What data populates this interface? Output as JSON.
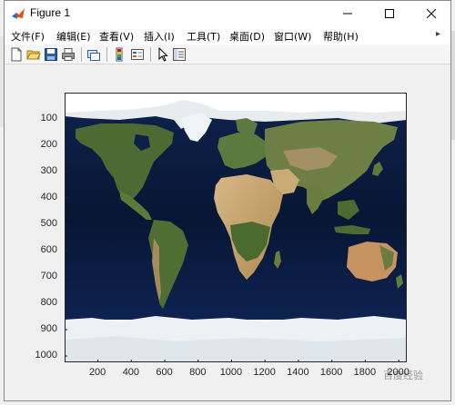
{
  "window": {
    "title": "Figure 1"
  },
  "menubar": {
    "items": [
      {
        "label": "文件(F)"
      },
      {
        "label": "编辑(E)"
      },
      {
        "label": "查看(V)"
      },
      {
        "label": "插入(I)"
      },
      {
        "label": "工具(T)"
      },
      {
        "label": "桌面(D)"
      },
      {
        "label": "窗口(W)"
      },
      {
        "label": "帮助(H)"
      }
    ]
  },
  "toolbar": {
    "buttons": [
      "new-figure-icon",
      "open-file-icon",
      "save-icon",
      "print-icon",
      "link-plot-icon",
      "insert-colorbar-icon",
      "insert-legend-icon",
      "edit-plot-pointer-icon",
      "property-inspector-icon"
    ]
  },
  "axes": {
    "xticks": [
      "200",
      "400",
      "600",
      "800",
      "1000",
      "1200",
      "1400",
      "1600",
      "1800",
      "2000"
    ],
    "yticks": [
      "100",
      "200",
      "300",
      "400",
      "500",
      "600",
      "700",
      "800",
      "900",
      "1000"
    ],
    "xlim": [
      1,
      2048
    ],
    "ylim": [
      1,
      1024
    ]
  },
  "image": {
    "type": "world-map-satellite-image"
  },
  "watermark": {
    "text": "百度经验"
  },
  "colors": {
    "ocean": "#0b1a3c",
    "land": "#4e6b34",
    "desert": "#c4a06a",
    "ice": "#eef1f4"
  }
}
